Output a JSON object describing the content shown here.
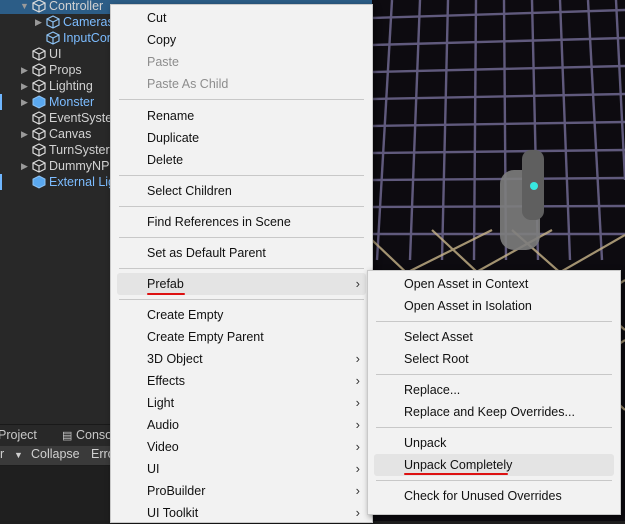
{
  "hierarchy": {
    "items": [
      {
        "label": "Controller",
        "expanded": true,
        "prefab": false,
        "selected": true
      },
      {
        "label": "Cameras",
        "prefab": true
      },
      {
        "label": "InputCon",
        "prefab": true
      },
      {
        "label": "UI",
        "prefab": false
      },
      {
        "label": "Props",
        "prefab": false
      },
      {
        "label": "Lighting",
        "prefab": false
      },
      {
        "label": "Monster",
        "prefab": true
      },
      {
        "label": "EventSyste",
        "prefab": false
      },
      {
        "label": "Canvas",
        "prefab": false
      },
      {
        "label": "TurnSyster",
        "prefab": false
      },
      {
        "label": "DummyNP",
        "prefab": false
      },
      {
        "label": "External Lig",
        "prefab": true
      }
    ]
  },
  "bottom_panel": {
    "tabs": [
      "Project",
      "Console"
    ],
    "toolbar": {
      "clear": "r",
      "collapse": "Collapse",
      "error": "Erro"
    }
  },
  "context_menu": {
    "items": [
      "Cut",
      "Copy",
      "Paste",
      "Paste As Child",
      "Rename",
      "Duplicate",
      "Delete",
      "Select Children",
      "Find References in Scene",
      "Set as Default Parent",
      "Prefab",
      "Create Empty",
      "Create Empty Parent",
      "3D Object",
      "Effects",
      "Light",
      "Audio",
      "Video",
      "UI",
      "ProBuilder",
      "UI Toolkit"
    ],
    "disabled": [
      "Paste",
      "Paste As Child"
    ],
    "highlighted": "Prefab"
  },
  "prefab_submenu": {
    "items": [
      "Open Asset in Context",
      "Open Asset in Isolation",
      "Select Asset",
      "Select Root",
      "Replace...",
      "Replace and Keep Overrides...",
      "Unpack",
      "Unpack Completely",
      "Check for Unused Overrides"
    ],
    "highlighted": "Unpack Completely"
  },
  "colors": {
    "selection": "#2c5d87",
    "prefab_text": "#7cbcff",
    "annotation": "#dd1111"
  },
  "icons": {
    "cube": "cube-icon",
    "arrow": "chevron-right-icon",
    "console": "console-icon"
  }
}
